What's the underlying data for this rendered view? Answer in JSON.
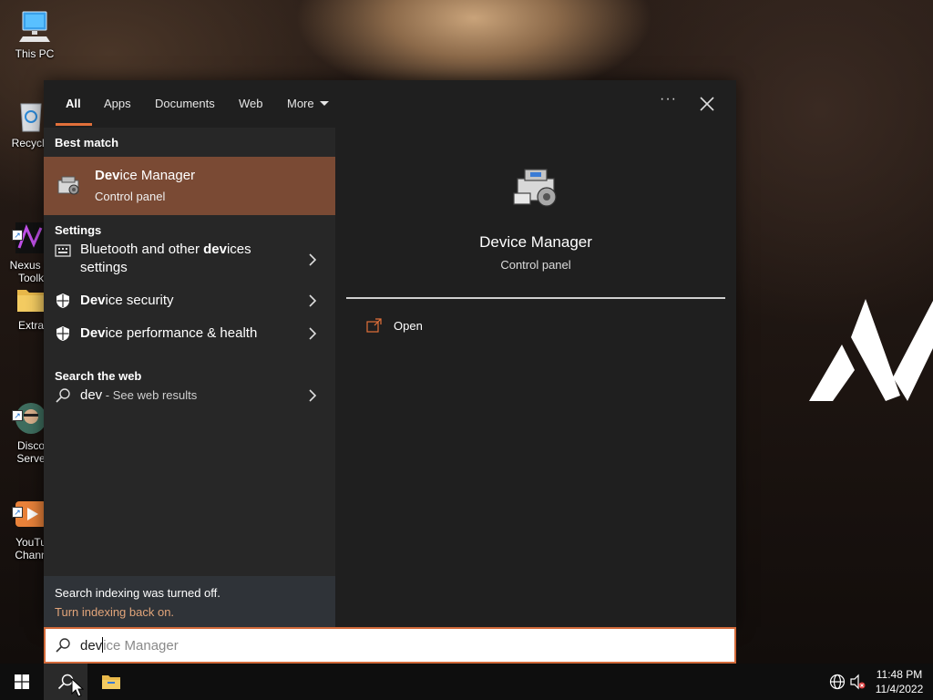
{
  "desktop": {
    "icons": [
      {
        "label": "This PC"
      },
      {
        "label": "Recycle"
      },
      {
        "label": "Nexus Li\nToolk"
      },
      {
        "label": "Extra"
      },
      {
        "label": "Disco\nServe"
      },
      {
        "label": "YouTu\nChann"
      }
    ]
  },
  "search": {
    "tabs": [
      {
        "label": "All"
      },
      {
        "label": "Apps"
      },
      {
        "label": "Documents"
      },
      {
        "label": "Web"
      },
      {
        "label": "More"
      }
    ],
    "options_icon": "···",
    "best_match_header": "Best match",
    "best_match": {
      "name_bold": "Dev",
      "name_rest": "ice Manager",
      "subtitle": "Control panel"
    },
    "settings_header": "Settings",
    "settings_items": [
      {
        "pre": "Bluetooth and other ",
        "bold": "dev",
        "post": "ices",
        "line2": "settings"
      },
      {
        "pre": "",
        "bold": "Dev",
        "post": "ice security"
      },
      {
        "pre": "",
        "bold": "Dev",
        "post": "ice performance & health"
      }
    ],
    "web_header": "Search the web",
    "web_query": "dev",
    "web_suffix": " - See web results",
    "indexing_notice": "Search indexing was turned off.",
    "indexing_link": "Turn indexing back on.",
    "preview": {
      "title": "Device Manager",
      "subtitle": "Control panel",
      "open_action": "Open"
    },
    "input": {
      "typed": "dev",
      "suggestion_rest": "ice Manager"
    }
  },
  "taskbar": {
    "time": "11:48 PM",
    "date": "11/4/2022"
  }
}
